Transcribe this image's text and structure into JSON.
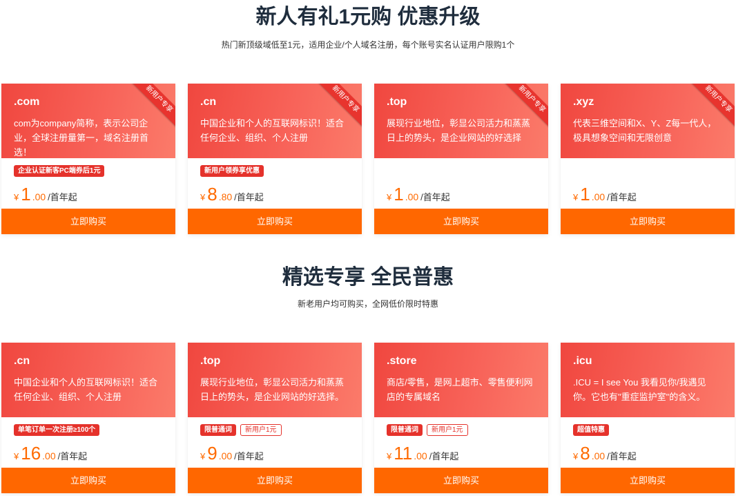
{
  "sections": [
    {
      "title": "新人有礼1元购 优惠升级",
      "subtitle": "热门新顶级域低至1元，适用企业/个人域名注册，每个账号实名认证用户限购1个",
      "cards": [
        {
          "suffix": ".com",
          "desc": "com为company简称，表示公司企业，全球注册量第一，域名注册首选！",
          "ribbon": "新用户专享",
          "tags": [
            {
              "text": "企业认证新客PC端券后1元",
              "style": "solid"
            }
          ],
          "currency": "¥",
          "price_int": "1",
          "price_dec": ".00",
          "unit": "/首年起",
          "buy": "立即购买"
        },
        {
          "suffix": ".cn",
          "desc": "中国企业和个人的互联网标识！适合任何企业、组织、个人注册",
          "ribbon": "新用户专享",
          "tags": [
            {
              "text": "新用户领券享优惠",
              "style": "solid"
            }
          ],
          "currency": "¥",
          "price_int": "8",
          "price_dec": ".80",
          "unit": "/首年起",
          "buy": "立即购买"
        },
        {
          "suffix": ".top",
          "desc": "展现行业地位，彰显公司活力和蒸蒸日上的势头，是企业网站的好选择",
          "ribbon": "新用户专享",
          "tags": [],
          "currency": "¥",
          "price_int": "1",
          "price_dec": ".00",
          "unit": "/首年起",
          "buy": "立即购买"
        },
        {
          "suffix": ".xyz",
          "desc": "代表三维空间和X、Y、Z每一代人，极具想象空间和无限创意",
          "ribbon": "新用户专享",
          "tags": [],
          "currency": "¥",
          "price_int": "1",
          "price_dec": ".00",
          "unit": "/首年起",
          "buy": "立即购买"
        }
      ]
    },
    {
      "title": "精选专享 全民普惠",
      "subtitle": "新老用户均可购买，全网低价限时特惠",
      "cards": [
        {
          "suffix": ".cn",
          "desc": "中国企业和个人的互联网标识！适合任何企业、组织、个人注册",
          "ribbon": "",
          "tags": [
            {
              "text": "单笔订单一次注册≥100个",
              "style": "solid"
            }
          ],
          "currency": "¥",
          "price_int": "16",
          "price_dec": ".00",
          "unit": "/首年起",
          "buy": "立即购买"
        },
        {
          "suffix": ".top",
          "desc": "展现行业地位，彰显公司活力和蒸蒸日上的势头，是企业网站的好选择。",
          "ribbon": "",
          "tags": [
            {
              "text": "限普通词",
              "style": "solid"
            },
            {
              "text": "新用户1元",
              "style": "outline"
            }
          ],
          "currency": "¥",
          "price_int": "9",
          "price_dec": ".00",
          "unit": "/首年起",
          "buy": "立即购买"
        },
        {
          "suffix": ".store",
          "desc": "商店/零售，是网上超市、零售便利网店的专属域名",
          "ribbon": "",
          "tags": [
            {
              "text": "限普通词",
              "style": "solid"
            },
            {
              "text": "新用户1元",
              "style": "outline"
            }
          ],
          "currency": "¥",
          "price_int": "11",
          "price_dec": ".00",
          "unit": "/首年起",
          "buy": "立即购买"
        },
        {
          "suffix": ".icu",
          "desc": ".ICU = I see You 我看见你/我遇见你。它也有\"重症监护室\"的含义。",
          "ribbon": "",
          "tags": [
            {
              "text": "超值特惠",
              "style": "solid"
            }
          ],
          "currency": "¥",
          "price_int": "8",
          "price_dec": ".00",
          "unit": "/首年起",
          "buy": "立即购买"
        }
      ]
    }
  ]
}
